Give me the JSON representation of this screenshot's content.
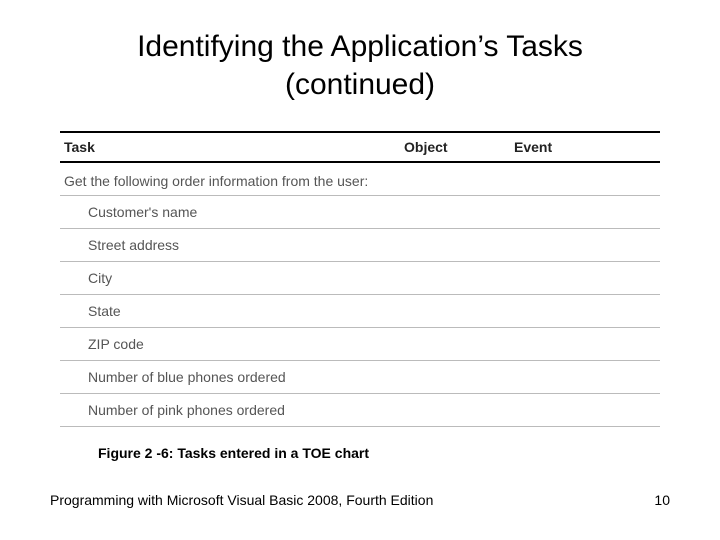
{
  "title_line1": "Identifying the Application’s Tasks",
  "title_line2": "(continued)",
  "table": {
    "headers": {
      "task": "Task",
      "object": "Object",
      "event": "Event"
    },
    "intro": "Get the following order information from the user:",
    "items": [
      "Customer's name",
      "Street address",
      "City",
      "State",
      "ZIP code",
      "Number of blue phones ordered",
      "Number of pink phones ordered"
    ]
  },
  "caption": "Figure 2 -6: Tasks entered in a TOE chart",
  "footer": "Programming with Microsoft Visual Basic 2008, Fourth Edition",
  "page_number": "10"
}
